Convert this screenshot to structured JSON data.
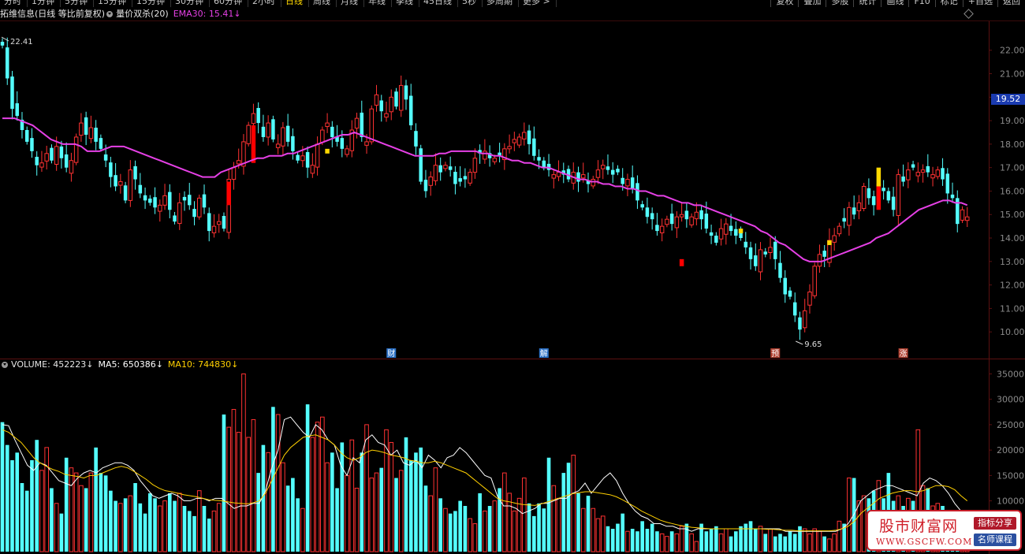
{
  "toolbar": {
    "periods": [
      "分时",
      "1分钟",
      "5分钟",
      "15分钟",
      "15分钟",
      "30分钟",
      "60分钟",
      "2小时",
      "日线",
      "周线",
      "月线",
      "年线",
      "季线",
      "45日线",
      "5秒",
      "多周期",
      "更多 >"
    ],
    "active_period": "日线",
    "tools": [
      "复权",
      "叠加",
      "多股",
      "统计",
      "画线",
      "F10",
      "标记",
      "+自选",
      "返回"
    ]
  },
  "kline_header": {
    "stock_name": "拓维信息(日线 等比前复权)",
    "indicator_name": "量价双杀(20)",
    "ema_label": "EMA30: 15.41",
    "ema_arrow": "↓"
  },
  "volume_header": {
    "volume_label": "VOLUME: 452223",
    "volume_arrow": "↓",
    "ma5_label": "MA5: 650386",
    "ma5_arrow": "↓",
    "ma10_label": "MA10: 744830",
    "ma10_arrow": "↓"
  },
  "current_price": "19.52",
  "annotations": {
    "high": "22.41",
    "low": "9.65"
  },
  "event_markers": [
    {
      "label": "财",
      "color": "#2a6fc4",
      "text_color": "#ffffff",
      "index": 79
    },
    {
      "label": "解",
      "color": "#2a6fc4",
      "text_color": "#ffffff",
      "index": 110
    },
    {
      "label": "预",
      "color": "#b04030",
      "text_color": "#ffffff",
      "index": 157
    },
    {
      "label": "涨",
      "color": "#b04030",
      "text_color": "#ffffff",
      "index": 183
    }
  ],
  "colors": {
    "up": "#ff3232",
    "down": "#54ffff",
    "ema": "#e640e6",
    "ma5": "#ffffff",
    "ma10": "#ffd000",
    "highlight_up": "#ff0000",
    "highlight_yellow": "#ffd800",
    "axis_text": "#8a8a8a",
    "active": "#ffd800"
  },
  "chart_data": {
    "type": "candlestick",
    "price_axis_ticks": [
      22,
      21,
      20,
      19,
      18,
      17,
      16,
      15,
      14,
      13,
      12,
      11,
      10
    ],
    "price_range": [
      9.2,
      23.2
    ],
    "volume_axis_ticks": [
      35000,
      30000,
      25000,
      20000,
      15000,
      10000
    ],
    "volume_range": [
      0,
      36000
    ],
    "closes": [
      22.2,
      20.8,
      19.5,
      19.2,
      18.6,
      18.1,
      17.7,
      17.1,
      17.2,
      17.6,
      17.3,
      17.9,
      17.4,
      17.0,
      17.3,
      18.3,
      18.9,
      18.4,
      18.7,
      18.1,
      17.8,
      17.3,
      16.6,
      16.2,
      16.4,
      15.6,
      16.9,
      16.5,
      15.9,
      15.6,
      15.5,
      15.3,
      15.4,
      15.8,
      15.2,
      14.7,
      15.5,
      15.6,
      15.4,
      14.9,
      15.7,
      15.3,
      14.3,
      14.5,
      14.7,
      14.4,
      16.5,
      17.0,
      17.3,
      18.1,
      18.8,
      19.3,
      18.9,
      18.3,
      18.9,
      18.2,
      18.0,
      18.7,
      18.1,
      17.7,
      17.3,
      17.5,
      17.0,
      17.1,
      18.0,
      18.6,
      18.9,
      18.3,
      18.1,
      17.8,
      17.8,
      18.6,
      19.1,
      18.3,
      18.1,
      19.5,
      20.1,
      19.4,
      19.3,
      20.0,
      19.6,
      20.5,
      19.9,
      18.8,
      17.9,
      16.4,
      16.0,
      16.6,
      17.1,
      16.8,
      17.1,
      16.9,
      16.3,
      16.4,
      16.5,
      16.8,
      17.4,
      17.6,
      17.7,
      17.4,
      17.4,
      17.5,
      17.8,
      17.9,
      18.2,
      18.3,
      18.5,
      18.0,
      17.5,
      17.3,
      17.0,
      16.9,
      16.7,
      16.8,
      16.7,
      16.5,
      16.8,
      16.4,
      16.7,
      16.3,
      16.5,
      16.9,
      17.1,
      16.9,
      16.7,
      16.8,
      16.3,
      16.5,
      16.1,
      15.6,
      15.3,
      14.9,
      14.8,
      14.3,
      14.5,
      14.8,
      14.6,
      14.9,
      15.0,
      14.8,
      14.9,
      15.1,
      14.8,
      14.4,
      14.1,
      13.8,
      14.4,
      14.6,
      14.3,
      14.1,
      14.0,
      13.6,
      13.1,
      12.8,
      13.5,
      13.3,
      13.6,
      13.1,
      12.3,
      11.6,
      11.5,
      10.7,
      10.1,
      10.9,
      11.7,
      12.8,
      13.3,
      13.2,
      13.9,
      14.1,
      14.5,
      14.7,
      15.3,
      15.0,
      15.5,
      16.2,
      15.7,
      15.4,
      16.3,
      16.0,
      15.6,
      15.2,
      16.7,
      16.4,
      16.9,
      17.0,
      16.8,
      16.9,
      16.8,
      16.7,
      16.9,
      16.5,
      15.9,
      15.7,
      14.6,
      15.2,
      14.9
    ],
    "volumes": [
      25500,
      21000,
      18000,
      19500,
      13500,
      12000,
      18000,
      22000,
      16000,
      20500,
      12500,
      9500,
      7500,
      18500,
      16500,
      15500,
      13000,
      12500,
      15500,
      20500,
      15500,
      15000,
      12000,
      10000,
      9500,
      10500,
      11000,
      13500,
      9500,
      7500,
      11500,
      10500,
      9000,
      10000,
      11500,
      10000,
      11500,
      9000,
      8000,
      7000,
      12000,
      9000,
      6500,
      8000,
      9500,
      27000,
      24500,
      28000,
      23500,
      35000,
      22500,
      26000,
      15500,
      21000,
      19500,
      28500,
      27000,
      17500,
      13000,
      14500,
      10500,
      8500,
      29000,
      22500,
      25500,
      26500,
      17500,
      19500,
      12500,
      21500,
      15000,
      22000,
      12500,
      19500,
      25000,
      14500,
      15500,
      16500,
      24000,
      21500,
      14500,
      16000,
      22500,
      18000,
      19500,
      20500,
      13000,
      11000,
      16500,
      10500,
      8500,
      7500,
      8000,
      10000,
      9000,
      6500,
      5500,
      11500,
      8000,
      9000,
      10000,
      12500,
      15500,
      11500,
      8000,
      10500,
      14500,
      9500,
      7000,
      9500,
      8500,
      18500,
      13000,
      10500,
      15500,
      17500,
      19000,
      11500,
      8500,
      11000,
      8500,
      6500,
      7000,
      5000,
      4500,
      5500,
      7500,
      4000,
      4500,
      4000,
      6000,
      4500,
      5500,
      4000,
      3500,
      3000,
      4000,
      3500,
      5000,
      5500,
      3500,
      2000,
      5500,
      4000,
      4500,
      5000,
      3500,
      4500,
      3000,
      4000,
      5000,
      5500,
      6000,
      4500,
      5000,
      3500,
      4500,
      3000,
      3500,
      3000,
      4000,
      3500,
      5000,
      4500,
      3500,
      4500,
      4000,
      3000,
      2500,
      3500,
      6000,
      5500,
      14500,
      14500,
      10000,
      11000,
      10500,
      12000,
      14000,
      10500,
      15500,
      10000,
      11000,
      9000,
      10500,
      10000,
      24000,
      13000,
      12500,
      9000,
      9500,
      9000,
      7000,
      6500,
      6000,
      5000,
      3500
    ],
    "ema30": [
      19.1,
      19.1,
      19.1,
      19.0,
      18.9,
      18.8,
      18.6,
      18.4,
      18.2,
      18.1,
      18.0,
      18.0,
      18.0,
      17.9,
      17.7,
      17.7,
      17.7,
      17.8,
      17.9,
      17.9,
      17.9,
      17.8,
      17.7,
      17.6,
      17.5,
      17.4,
      17.3,
      17.2,
      17.1,
      17.0,
      16.9,
      16.8,
      16.7,
      16.6,
      16.6,
      16.6,
      16.8,
      16.9,
      17.0,
      17.1,
      17.2,
      17.3,
      17.4,
      17.4,
      17.5,
      17.5,
      17.5,
      17.6,
      17.6,
      17.7,
      17.8,
      17.9,
      18.0,
      18.1,
      18.2,
      18.3,
      18.4,
      18.4,
      18.5,
      18.4,
      18.3,
      18.2,
      18.1,
      18.0,
      17.9,
      17.8,
      17.7,
      17.6,
      17.5,
      17.5,
      17.5,
      17.5,
      17.6,
      17.6,
      17.7,
      17.7,
      17.7,
      17.7,
      17.7,
      17.6,
      17.6,
      17.5,
      17.5,
      17.4,
      17.3,
      17.3,
      17.2,
      17.2,
      17.1,
      17.0,
      17.0,
      16.9,
      16.8,
      16.7,
      16.6,
      16.5,
      16.5,
      16.4,
      16.4,
      16.3,
      16.3,
      16.2,
      16.2,
      16.1,
      16.1,
      16.0,
      16.0,
      15.9,
      15.8,
      15.8,
      15.7,
      15.6,
      15.5,
      15.5,
      15.4,
      15.4,
      15.3,
      15.2,
      15.1,
      15.0,
      14.9,
      14.8,
      14.7,
      14.6,
      14.5,
      14.3,
      14.2,
      14.0,
      13.8,
      13.7,
      13.5,
      13.3,
      13.1,
      13.0,
      13.0,
      13.0,
      13.1,
      13.2,
      13.3,
      13.4,
      13.5,
      13.6,
      13.7,
      13.8,
      14.0,
      14.1,
      14.2,
      14.4,
      14.6,
      14.8,
      15.0,
      15.2,
      15.3,
      15.4,
      15.5,
      15.6,
      15.6,
      15.5,
      15.5,
      15.4
    ],
    "ma5": [
      25000,
      24800,
      22000,
      19500,
      17000,
      16000,
      17500,
      17000,
      15500,
      14000,
      13500,
      13000,
      14500,
      15500,
      16000,
      15500,
      16500,
      17000,
      17500,
      17500,
      17000,
      16000,
      14000,
      12500,
      11000,
      10500,
      11000,
      11500,
      11000,
      10000,
      10000,
      10500,
      10500,
      10000,
      10500,
      10500,
      9500,
      8500,
      9000,
      9000,
      9500,
      9500,
      12000,
      16500,
      20000,
      26000,
      26500,
      25000,
      23500,
      22500,
      25000,
      24000,
      22000,
      21000,
      17000,
      15000,
      18500,
      17500,
      22000,
      23000,
      21500,
      21000,
      19000,
      20000,
      17500,
      17000,
      18000,
      16500,
      19000,
      18000,
      16500,
      18500,
      19000,
      20500,
      19500,
      18000,
      16500,
      15000,
      14500,
      11000,
      9000,
      9000,
      8500,
      7500,
      8000,
      8500,
      9500,
      9500,
      10000,
      10500,
      10500,
      11500,
      12000,
      13500,
      11500,
      13000,
      14500,
      15500,
      14000,
      11500,
      9500,
      8000,
      7000,
      6500,
      5500,
      5500,
      5000,
      5000,
      4500,
      4500,
      4000,
      4500,
      4500,
      4500,
      4500,
      4500,
      4500,
      4500,
      4500,
      4500,
      4500,
      4500,
      4500,
      4500,
      4500,
      4000,
      4000,
      4000,
      4000,
      4000,
      4000,
      4000,
      4000,
      4000,
      4500,
      5500,
      7500,
      10000,
      11000,
      12000,
      12500,
      13000,
      13000,
      12500,
      12000,
      11500,
      11000,
      13500,
      14500,
      14000,
      13000,
      11500,
      9500,
      8000,
      6500
    ],
    "ma10": [
      24000,
      23500,
      22500,
      21500,
      20000,
      18500,
      17500,
      16800,
      16200,
      15800,
      15200,
      15000,
      14800,
      14500,
      15000,
      15000,
      15500,
      16000,
      16500,
      16800,
      16500,
      15800,
      15000,
      14200,
      13200,
      12500,
      12000,
      11800,
      11500,
      11200,
      11000,
      10800,
      10500,
      10200,
      10100,
      10000,
      9800,
      9600,
      9500,
      9400,
      9600,
      10000,
      11500,
      14000,
      16500,
      19000,
      20500,
      21500,
      22500,
      22800,
      23000,
      22500,
      22000,
      21000,
      19500,
      18500,
      18000,
      18500,
      19500,
      20000,
      19800,
      19500,
      19000,
      18800,
      18500,
      18000,
      17800,
      17500,
      17500,
      17800,
      17500,
      17000,
      16500,
      16000,
      15500,
      14500,
      13500,
      12500,
      11500,
      10500,
      10000,
      9800,
      9500,
      9300,
      9200,
      9100,
      9400,
      9800,
      10200,
      10600,
      11000,
      11400,
      11600,
      11800,
      11800,
      11600,
      11400,
      11200,
      10800,
      10200,
      9500,
      8800,
      8000,
      7400,
      6800,
      6200,
      5800,
      5500,
      5200,
      5000,
      4800,
      4700,
      4600,
      4500,
      4500,
      4500,
      4500,
      4500,
      4500,
      4500,
      4500,
      4500,
      4400,
      4400,
      4300,
      4200,
      4200,
      4100,
      4100,
      4100,
      4100,
      4100,
      4100,
      4200,
      4500,
      5000,
      6000,
      7500,
      8500,
      9500,
      10500,
      11000,
      11500,
      11800,
      12000,
      12000,
      11800,
      12000,
      12500,
      13000,
      13000,
      12800,
      12200,
      11000,
      10000
    ]
  }
}
